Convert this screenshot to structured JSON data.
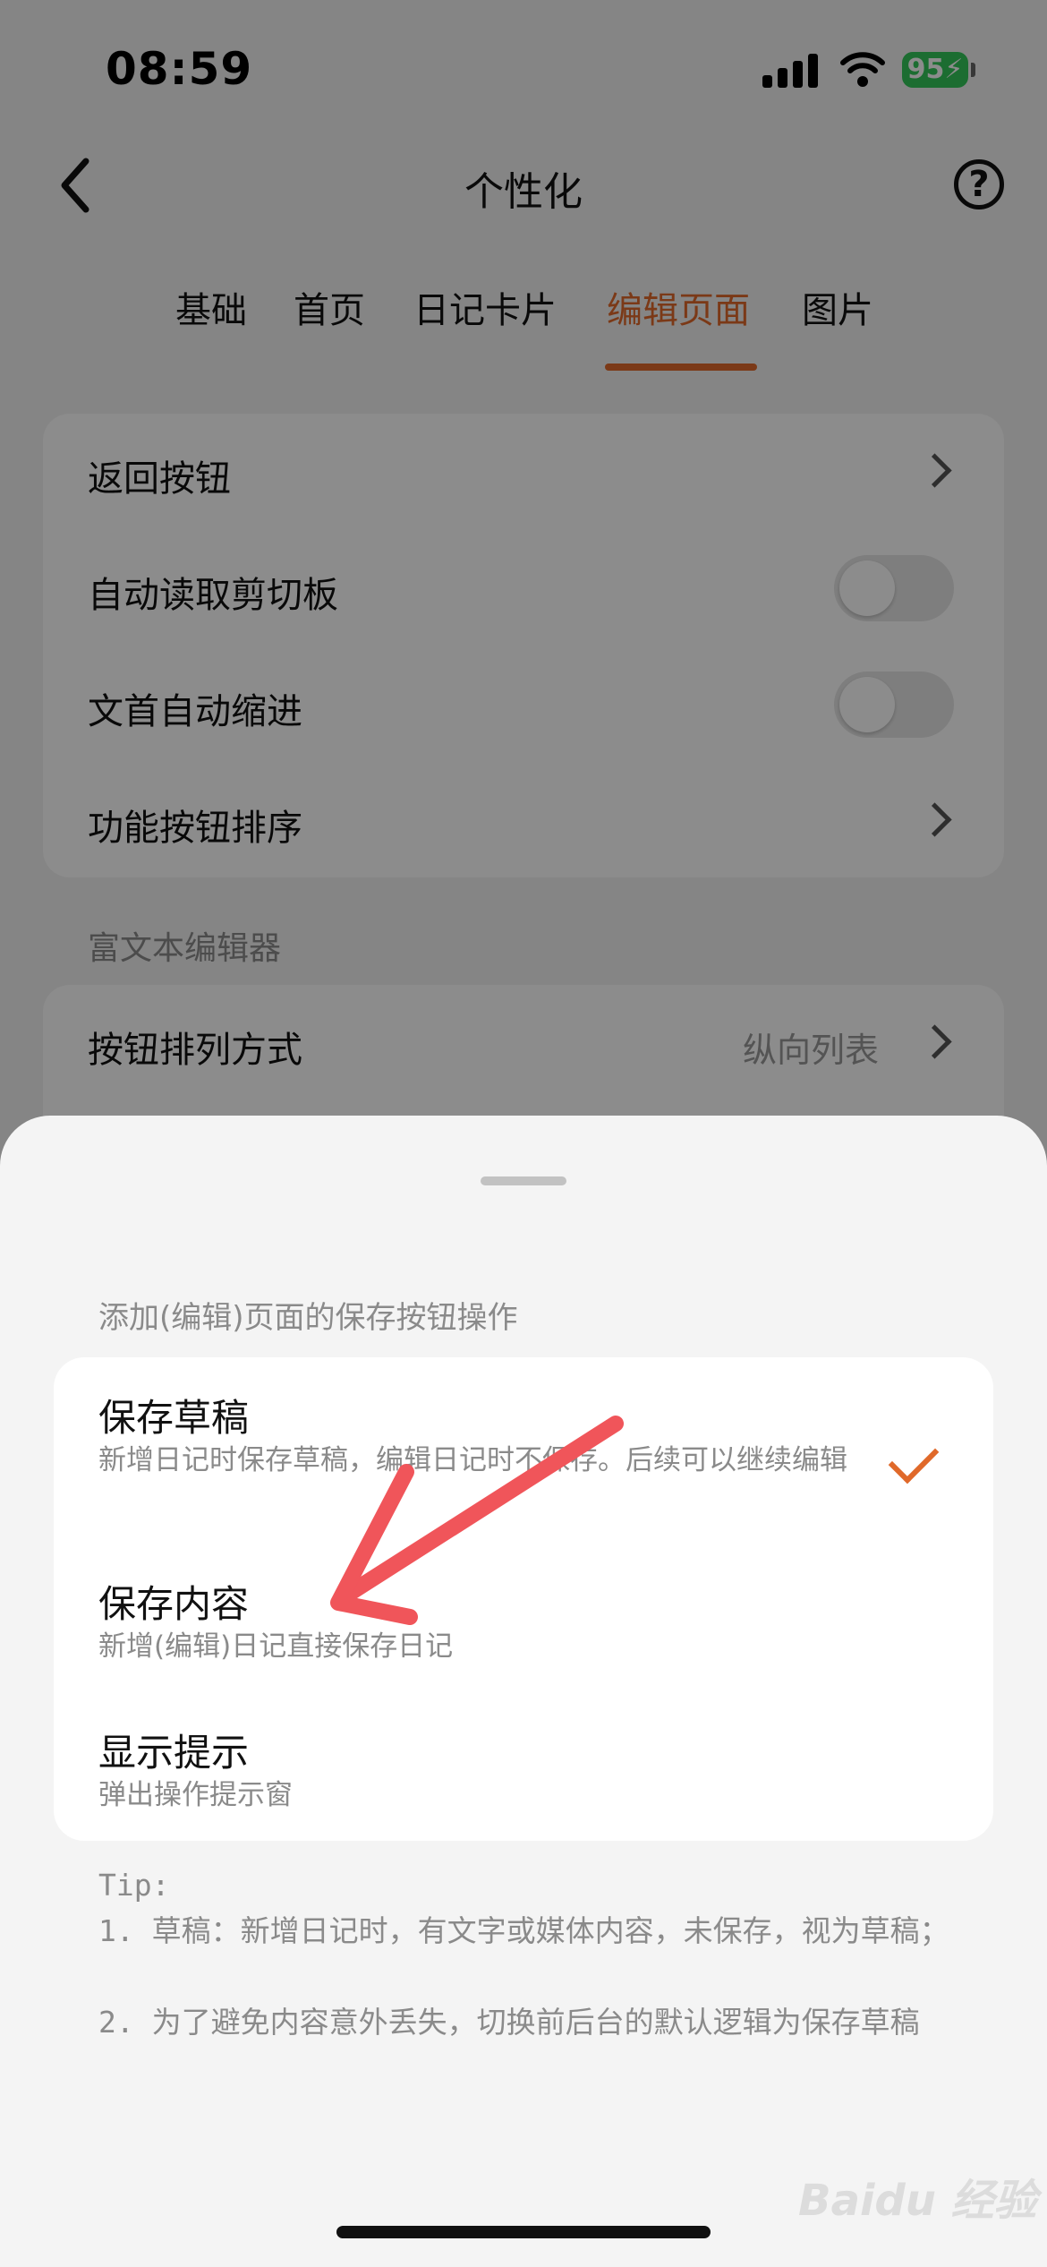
{
  "status_bar": {
    "time": "08:59",
    "battery": "95"
  },
  "header": {
    "title": "个性化",
    "help": "?"
  },
  "tabs": [
    {
      "label": "基础"
    },
    {
      "label": "首页"
    },
    {
      "label": "日记卡片"
    },
    {
      "label": "编辑页面",
      "active": true
    },
    {
      "label": "图片"
    }
  ],
  "settings": {
    "rows": [
      {
        "label": "返回按钮"
      },
      {
        "label": "自动读取剪切板",
        "toggle": false
      },
      {
        "label": "文首自动缩进",
        "toggle": false
      },
      {
        "label": "功能按钮排序"
      }
    ],
    "section_label": "富文本编辑器",
    "rich_row": {
      "label": "按钮排列方式",
      "value": "纵向列表"
    }
  },
  "sheet": {
    "title": "添加(编辑)页面的保存按钮操作",
    "options": [
      {
        "title": "保存草稿",
        "desc": "新增日记时保存草稿，编辑日记时不保存。后续可以继续编辑",
        "selected": true
      },
      {
        "title": "保存内容",
        "desc": "新增(编辑)日记直接保存日记"
      },
      {
        "title": "显示提示",
        "desc": "弹出操作提示窗"
      }
    ],
    "tip": {
      "heading": "Tip:",
      "line1": "1. 草稿：新增日记时，有文字或媒体内容，未保存，视为草稿；",
      "line2": "2. 为了避免内容意外丢失，切换前后台的默认逻辑为保存草稿"
    }
  },
  "watermark": "Baidu 经验",
  "colors": {
    "accent": "#e0692a",
    "arrow": "#f0555a",
    "battery": "#34c759"
  }
}
